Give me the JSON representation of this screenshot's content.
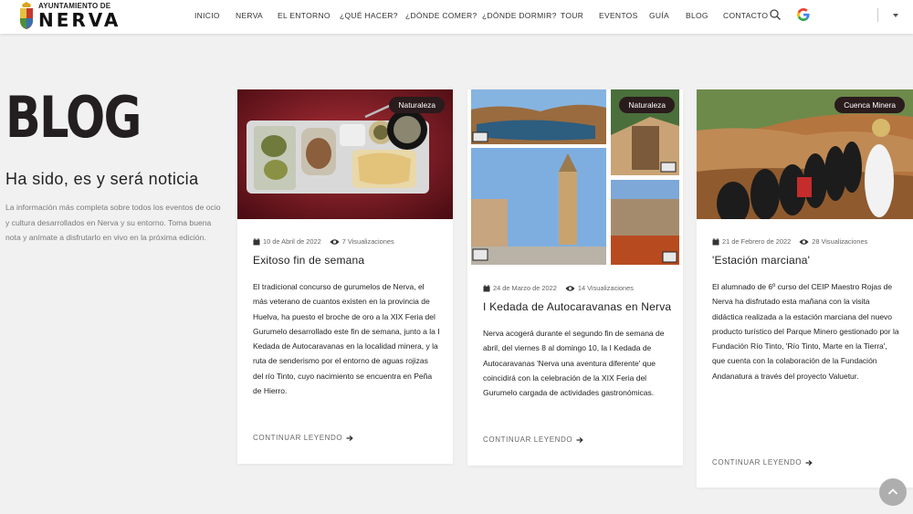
{
  "header": {
    "logo_small": "AYUNTAMIENTO DE",
    "logo_big": "NERVA",
    "nav": [
      "INICIO",
      "NERVA",
      "EL ENTORNO",
      "¿QUÉ HACER?",
      "¿DÓNDE COMER?",
      "¿DÓNDE DORMIR?",
      "TOUR",
      "EVENTOS",
      "GUÍA",
      "BLOG",
      "CONTACTO"
    ],
    "icons": [
      "search-icon",
      "google-translate-icon",
      "chevron-down-icon"
    ]
  },
  "intro": {
    "title": "BLOG",
    "subtitle": "Ha sido, es y será noticia",
    "description": "La información más completa sobre todos los eventos de ocio y cultura desarrollados en Nerva y su entorno. Toma buena nota y anímate a disfrutarlo en vivo en la próxima edición."
  },
  "posts": [
    {
      "tag": "Naturaleza",
      "date": "10 de Abril de 2022",
      "views": "7 Visualizaciones",
      "title": "Exitoso fin de semana",
      "text": "El tradicional concurso de gurumelos de Nerva, el más veterano de cuantos existen en la provincia de Huelva, ha puesto el broche de oro a la XIX Feria del Gurumelo desarrollado este fin de semana, junto a la I Kedada de Autocaravanas en la localidad minera, y la ruta de senderismo por el entorno de aguas rojizas del río Tinto, cuyo nacimiento se encuentra en Peña de Hierro.",
      "read_more": "CONTINUAR LEYENDO"
    },
    {
      "tag": "Naturaleza",
      "date": "24 de Marzo de 2022",
      "views": "14 Visualizaciones",
      "title": "I Kedada de Autocaravanas en Nerva",
      "text": "Nerva acogerá durante el segundo fin de semana de abril, del viernes 8 al domingo 10, la I Kedada de Autocaravanas 'Nerva una aventura diferente' que coincidirá con la celebración de la XIX Feria del Gurumelo cargada de actividades gastronómicas.",
      "read_more": "CONTINUAR LEYENDO"
    },
    {
      "tag": "Cuenca Minera",
      "date": "21 de Febrero de 2022",
      "views": "28 Visualizaciones",
      "title": "'Estación marciana'",
      "text": "El alumnado de 6º curso del CEIP Maestro Rojas de Nerva ha disfrutado esta mañana con la visita didáctica realizada a la estación marciana del nuevo producto turístico del Parque Minero gestionado por la Fundación Río Tinto, 'Río Tinto, Marte en la Tierra', que cuenta con la colaboración de la Fundación Andanatura a través del proyecto Valuetur.",
      "read_more": "CONTINUAR LEYENDO"
    }
  ],
  "colors": {
    "background": "#f1f1f1",
    "tag_background": "#2a1b1c",
    "title_text": "#231f20"
  }
}
